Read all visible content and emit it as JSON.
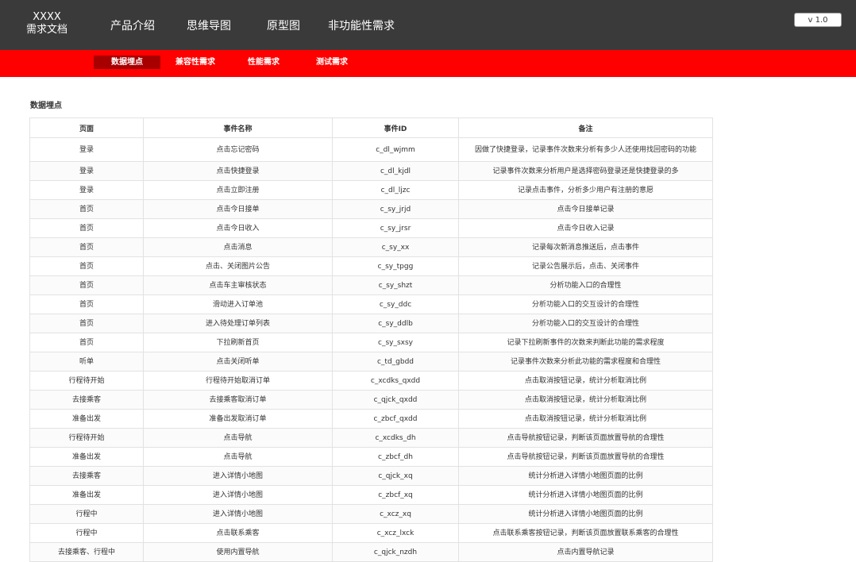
{
  "brand": {
    "line1": "XXXX",
    "line2": "需求文档"
  },
  "main_nav": [
    "产品介绍",
    "思维导图",
    "原型图",
    "非功能性需求"
  ],
  "version": "v 1.0",
  "sub_nav": [
    {
      "label": "数据埋点",
      "active": true
    },
    {
      "label": "兼容性需求",
      "active": false
    },
    {
      "label": "性能需求",
      "active": false
    },
    {
      "label": "测试需求",
      "active": false
    }
  ],
  "section_title": "数据埋点",
  "table": {
    "headers": [
      "页面",
      "事件名称",
      "事件ID",
      "备注"
    ],
    "rows": [
      [
        "登录",
        "点击忘记密码",
        "c_dl_wjmm",
        "因做了快捷登录，记录事件次数来分析有多少人还使用找回密码的功能"
      ],
      [
        "登录",
        "点击快捷登录",
        "c_dl_kjdl",
        "记录事件次数来分析用户是选择密码登录还是快捷登录的多"
      ],
      [
        "登录",
        "点击立即注册",
        "c_dl_ljzc",
        "记录点击事件，分析多少用户有注册的意愿"
      ],
      [
        "首页",
        "点击今日接单",
        "c_sy_jrjd",
        "点击今日接单记录"
      ],
      [
        "首页",
        "点击今日收入",
        "c_sy_jrsr",
        "点击今日收入记录"
      ],
      [
        "首页",
        "点击消息",
        "c_sy_xx",
        "记录每次新消息推送后，点击事件"
      ],
      [
        "首页",
        "点击、关闭图片公告",
        "c_sy_tpgg",
        "记录公告展示后，点击、关闭事件"
      ],
      [
        "首页",
        "点击车主审核状态",
        "c_sy_shzt",
        "分析功能入口的合理性"
      ],
      [
        "首页",
        "滑动进入订单池",
        "c_sy_ddc",
        "分析功能入口的交互设计的合理性"
      ],
      [
        "首页",
        "进入待处理订单列表",
        "c_sy_ddlb",
        "分析功能入口的交互设计的合理性"
      ],
      [
        "首页",
        "下拉刷新首页",
        "c_sy_sxsy",
        "记录下拉刷新事件的次数来判断此功能的需求程度"
      ],
      [
        "听单",
        "点击关闭听单",
        "c_td_gbdd",
        "记录事件次数来分析此功能的需求程度和合理性"
      ],
      [
        "行程待开始",
        "行程待开始取消订单",
        "c_xcdks_qxdd",
        "点击取消按钮记录，统计分析取消比例"
      ],
      [
        "去接乘客",
        "去接乘客取消订单",
        "c_qjck_qxdd",
        "点击取消按钮记录，统计分析取消比例"
      ],
      [
        "准备出发",
        "准备出发取消订单",
        "c_zbcf_qxdd",
        "点击取消按钮记录，统计分析取消比例"
      ],
      [
        "行程待开始",
        "点击导航",
        "c_xcdks_dh",
        "点击导航按钮记录，判断该页面放置导航的合理性"
      ],
      [
        "准备出发",
        "点击导航",
        "c_zbcf_dh",
        "点击导航按钮记录，判断该页面放置导航的合理性"
      ],
      [
        "去接乘客",
        "进入详情小地图",
        "c_qjck_xq",
        "统计分析进入详情小地图页面的比例"
      ],
      [
        "准备出发",
        "进入详情小地图",
        "c_zbcf_xq",
        "统计分析进入详情小地图页面的比例"
      ],
      [
        "行程中",
        "进入详情小地图",
        "c_xcz_xq",
        "统计分析进入详情小地图页面的比例"
      ],
      [
        "行程中",
        "点击联系乘客",
        "c_xcz_lxck",
        "点击联系乘客按钮记录，判断该页面放置联系乘客的合理性"
      ],
      [
        "去接乘客、行程中",
        "使用内置导航",
        "c_qjck_nzdh",
        "点击内置导航记录"
      ]
    ]
  }
}
